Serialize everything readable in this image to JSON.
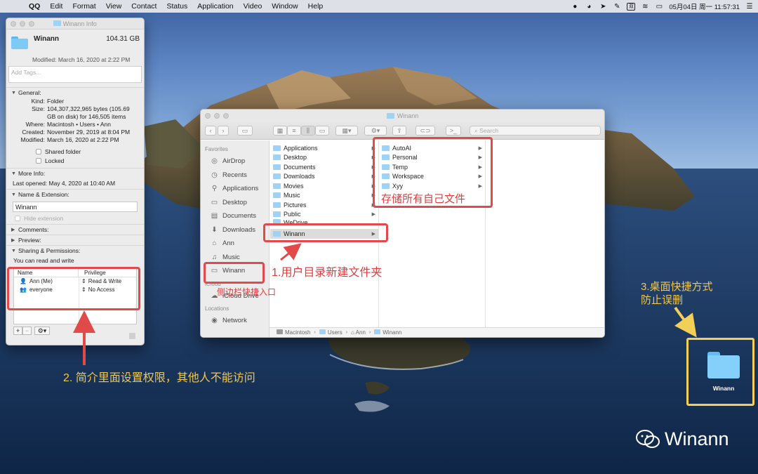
{
  "menubar": {
    "apple": "",
    "items": [
      "QQ",
      "Edit",
      "Format",
      "View",
      "Contact",
      "Status",
      "Application",
      "Video",
      "Window",
      "Help"
    ],
    "status_ime": "双",
    "clock": "05月04日 周一 11:57:31"
  },
  "info_window": {
    "title": "Winann Info",
    "name": "Winann",
    "size": "104.31 GB",
    "modified_line": "Modified: March 16, 2020 at 2:22 PM",
    "tags_placeholder": "Add Tags...",
    "general": {
      "header": "General:",
      "kind_k": "Kind:",
      "kind_v": "Folder",
      "size_k": "Size:",
      "size_v": "104,307,322,965 bytes (105.69 GB on disk) for 146,505 items",
      "where_k": "Where:",
      "where_v": "Macintosh • Users • Ann",
      "created_k": "Created:",
      "created_v": "November 29, 2019 at 8:04 PM",
      "modified_k": "Modified:",
      "modified_v": "March 16, 2020 at 2:22 PM",
      "shared": "Shared folder",
      "locked": "Locked"
    },
    "more_info": {
      "header": "More Info:",
      "last_opened": "Last opened: May 4, 2020 at 10:40 AM"
    },
    "name_ext": {
      "header": "Name & Extension:",
      "value": "Winann",
      "hide_ext": "Hide extension"
    },
    "comments": "Comments:",
    "preview": "Preview:",
    "sharing": {
      "header": "Sharing & Permissions:",
      "desc": "You can read and write",
      "col_name": "Name",
      "col_priv": "Privilege",
      "rows": [
        {
          "name": "Ann (Me)",
          "priv": "Read & Write"
        },
        {
          "name": "everyone",
          "priv": "No Access"
        }
      ],
      "add": "+",
      "remove": "−",
      "gear": "⚙▾"
    }
  },
  "finder": {
    "title": "Winann",
    "search_placeholder": "Search",
    "sidebar": {
      "favorites_header": "Favorites",
      "favorites": [
        "AirDrop",
        "Recents",
        "Applications",
        "Desktop",
        "Documents",
        "Downloads",
        "Ann",
        "Music",
        "Winann"
      ],
      "icloud_header": "iCloud",
      "icloud": [
        "iCloud Drive"
      ],
      "locations_header": "Locations",
      "locations": [
        "Network"
      ]
    },
    "col1": [
      "Applications",
      "Desktop",
      "Documents",
      "Downloads",
      "Movies",
      "Music",
      "Pictures",
      "Public",
      "WeDrive",
      "Winann"
    ],
    "col2": [
      "AutoAI",
      "Personal",
      "Temp",
      "Workspace",
      "Xyy"
    ],
    "path": [
      "Macintosh",
      "Users",
      "Ann",
      "Winann"
    ]
  },
  "annotations": {
    "store": "存储所有自己文件",
    "step1": "1.用户目录新建文件夹",
    "sidebar_shortcut": "侧边栏快捷入口",
    "step2": "2. 简介里面设置权限，其他人不能访问",
    "step3_line1": "3.桌面快捷方式",
    "step3_line2": "防止误删"
  },
  "desktop": {
    "folder_label": "Winann",
    "watermark": "Winann"
  },
  "colors": {
    "annotation_red": "#e24a4a",
    "annotation_yellow": "#f2cf56",
    "folder_blue": "#7ccaf5"
  }
}
